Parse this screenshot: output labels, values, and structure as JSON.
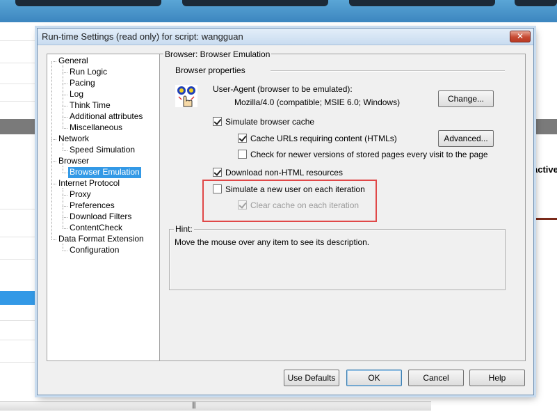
{
  "background": {
    "partial_label": "active"
  },
  "dialog": {
    "title": "Run-time Settings (read only) for script: wangguan",
    "close_label": "✕"
  },
  "tree": [
    {
      "label": "General",
      "level": 0
    },
    {
      "label": "Run Logic",
      "level": 1
    },
    {
      "label": "Pacing",
      "level": 1
    },
    {
      "label": "Log",
      "level": 1
    },
    {
      "label": "Think Time",
      "level": 1
    },
    {
      "label": "Additional attributes",
      "level": 1
    },
    {
      "label": "Miscellaneous",
      "level": 1
    },
    {
      "label": "Network",
      "level": 0
    },
    {
      "label": "Speed Simulation",
      "level": 1
    },
    {
      "label": "Browser",
      "level": 0
    },
    {
      "label": "Browser Emulation",
      "level": 1,
      "selected": true
    },
    {
      "label": "Internet Protocol",
      "level": 0
    },
    {
      "label": "Proxy",
      "level": 1
    },
    {
      "label": "Preferences",
      "level": 1
    },
    {
      "label": "Download Filters",
      "level": 1
    },
    {
      "label": "ContentCheck",
      "level": 1
    },
    {
      "label": "Data Format Extension",
      "level": 0
    },
    {
      "label": "Configuration",
      "level": 1
    }
  ],
  "panel": {
    "group_title": "Browser: Browser Emulation",
    "properties_title": "Browser properties",
    "user_agent_label": "User-Agent (browser to be emulated):",
    "user_agent_value": "Mozilla/4.0 (compatible; MSIE 6.0; Windows)",
    "change_button": "Change...",
    "simulate_cache_label": "Simulate browser cache",
    "simulate_cache_checked": true,
    "cache_urls_label": "Cache URLs requiring content (HTMLs)",
    "cache_urls_checked": true,
    "advanced_button": "Advanced...",
    "check_newer_label": "Check for newer versions of stored pages every visit to the page",
    "check_newer_checked": false,
    "download_nonhtml_label": "Download non-HTML resources",
    "download_nonhtml_checked": true,
    "simulate_new_user_label": "Simulate a new user on each iteration",
    "simulate_new_user_checked": false,
    "clear_cache_label": "Clear cache on each iteration",
    "clear_cache_checked": true,
    "hint_title": "Hint:",
    "hint_text": "Move the mouse over any item to see its description."
  },
  "footer": {
    "use_defaults": "Use Defaults",
    "ok": "OK",
    "cancel": "Cancel",
    "help": "Help"
  },
  "colors": {
    "selection": "#3399e6",
    "highlight_border": "#e04848",
    "dialog_bg": "#f0f0f0"
  }
}
